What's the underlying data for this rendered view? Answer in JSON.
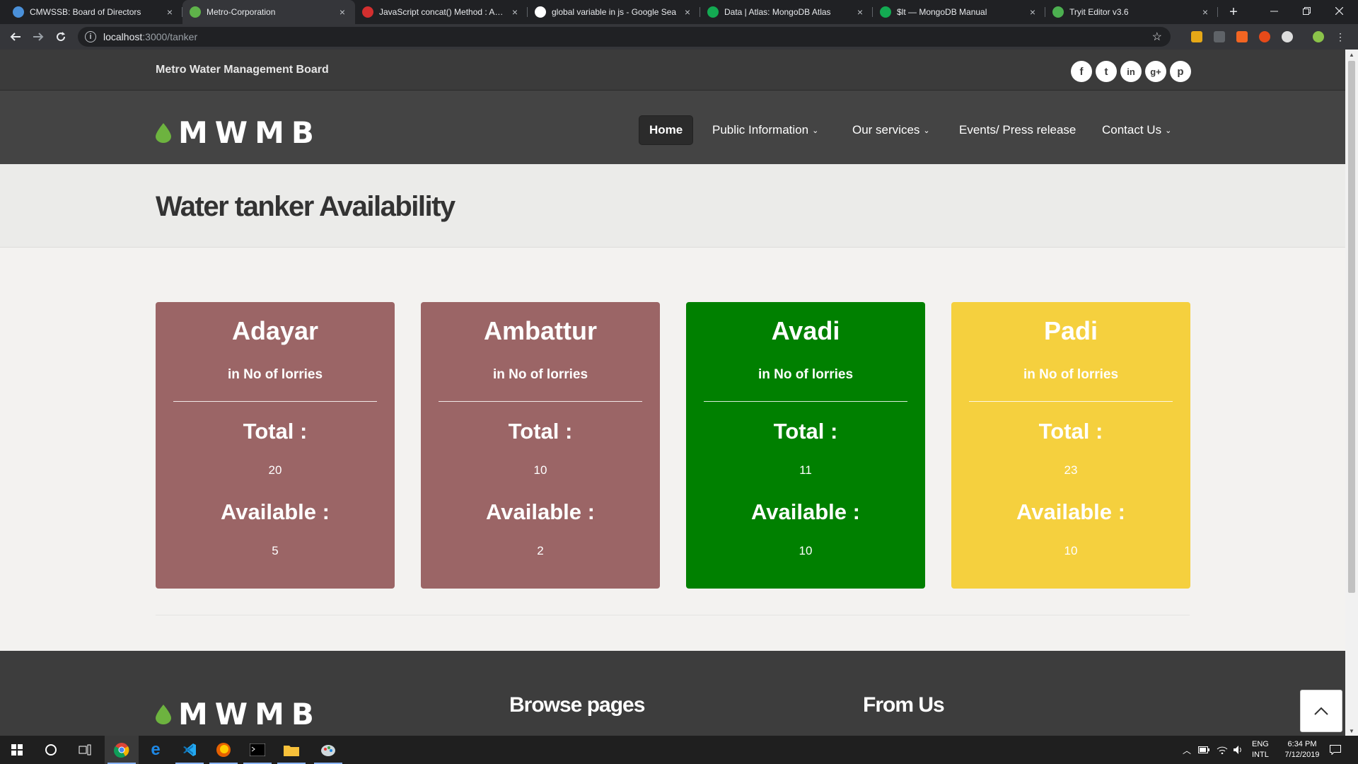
{
  "browser": {
    "tabs": [
      {
        "title": "CMWSSB: Board of Directors",
        "icon_color": "#4a90d9",
        "active": false
      },
      {
        "title": "Metro-Corporation",
        "icon_color": "#5fb34a",
        "active": true
      },
      {
        "title": "JavaScript concat() Method : Arra",
        "icon_color": "#d32f2f",
        "active": false
      },
      {
        "title": "global variable in js - Google Sea",
        "icon_color": "#ffffff",
        "active": false
      },
      {
        "title": "Data | Atlas: MongoDB Atlas",
        "icon_color": "#13aa52",
        "active": false
      },
      {
        "title": "$lt — MongoDB Manual",
        "icon_color": "#13aa52",
        "active": false
      },
      {
        "title": "Tryit Editor v3.6",
        "icon_color": "#4caf50",
        "active": false
      }
    ],
    "close_glyph": "×",
    "new_tab": "+",
    "url_host": "localhost",
    "url_path": ":3000/tanker",
    "info_glyph": "i"
  },
  "site": {
    "brand": "Metro Water Management Board",
    "logo_text": "MWMB",
    "social": [
      {
        "name": "facebook",
        "glyph": "f"
      },
      {
        "name": "twitter",
        "glyph": "t"
      },
      {
        "name": "linkedin",
        "glyph": "in"
      },
      {
        "name": "google-plus",
        "glyph": "g+"
      },
      {
        "name": "pinterest",
        "glyph": "p"
      }
    ],
    "nav": [
      {
        "label": "Home",
        "active": true,
        "caret": ""
      },
      {
        "label": "Public Information",
        "active": false,
        "caret": "⌄"
      },
      {
        "label": "Our services",
        "active": false,
        "caret": "⌄"
      },
      {
        "label": "Events/ Press release",
        "active": false,
        "caret": ""
      },
      {
        "label": "Contact Us",
        "active": false,
        "caret": "⌄"
      }
    ]
  },
  "page": {
    "title": "Water tanker Availability"
  },
  "cards": [
    {
      "name": "Adayar",
      "subtitle": "in No of lorries",
      "total_label": "Total :",
      "total": "20",
      "available_label": "Available :",
      "available": "5",
      "color": "#9b6566"
    },
    {
      "name": "Ambattur",
      "subtitle": "in No of lorries",
      "total_label": "Total :",
      "total": "10",
      "available_label": "Available :",
      "available": "2",
      "color": "#9b6566"
    },
    {
      "name": "Avadi",
      "subtitle": "in No of lorries",
      "total_label": "Total :",
      "total": "11",
      "available_label": "Available :",
      "available": "10",
      "color": "#008000"
    },
    {
      "name": "Padi",
      "subtitle": "in No of lorries",
      "total_label": "Total :",
      "total": "23",
      "available_label": "Available :",
      "available": "10",
      "color": "#f5d03e"
    }
  ],
  "footer": {
    "logo_text": "MWMB",
    "browse_heading": "Browse pages",
    "from_heading": "From Us"
  },
  "taskbar": {
    "language": "ENG",
    "layout": "INTL",
    "time": "6:34 PM",
    "date": "7/12/2019"
  }
}
